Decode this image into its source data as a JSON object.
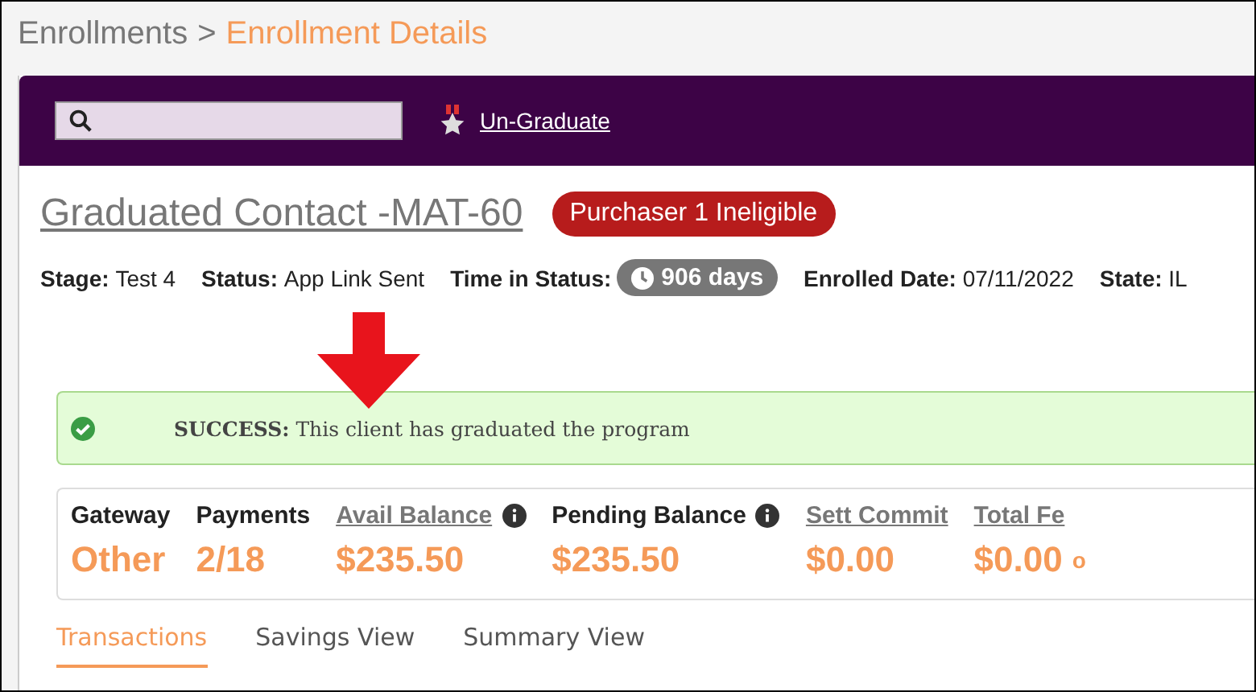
{
  "breadcrumb": {
    "parent": "Enrollments",
    "separator": ">",
    "current": "Enrollment Details"
  },
  "toolbar": {
    "action": "Un-Graduate"
  },
  "title": "Graduated Contact -MAT-60",
  "badge": "Purchaser 1 Ineligible",
  "info": [
    {
      "label": "Stage:",
      "value": "Test 4",
      "kind": "text"
    },
    {
      "label": "Status:",
      "value": "App Link Sent",
      "kind": "text"
    },
    {
      "label": "Time in Status:",
      "value": "906 days",
      "kind": "pill"
    },
    {
      "label": "Enrolled Date:",
      "value": "07/11/2022",
      "kind": "text"
    },
    {
      "label": "State:",
      "value": "IL",
      "kind": "text"
    }
  ],
  "alert": {
    "kind": "success",
    "label": "SUCCESS:",
    "message": "This client has graduated the program"
  },
  "stats": [
    {
      "label": "Gateway",
      "value": "Other",
      "link": false,
      "info": false
    },
    {
      "label": "Payments",
      "value": "2/18",
      "link": false,
      "info": false
    },
    {
      "label": "Avail Balance",
      "value": "$235.50",
      "link": true,
      "info": true
    },
    {
      "label": "Pending Balance",
      "value": "$235.50",
      "link": false,
      "info": true
    },
    {
      "label": "Sett Commit",
      "value": "$0.00",
      "link": true,
      "info": false
    },
    {
      "label": "Total Fe",
      "value": "$0.00",
      "suffix": "o",
      "link": true,
      "info": false
    }
  ],
  "tabs": [
    {
      "label": "Transactions",
      "selected": true
    },
    {
      "label": "Savings View",
      "selected": false
    },
    {
      "label": "Summary View",
      "selected": false
    }
  ]
}
